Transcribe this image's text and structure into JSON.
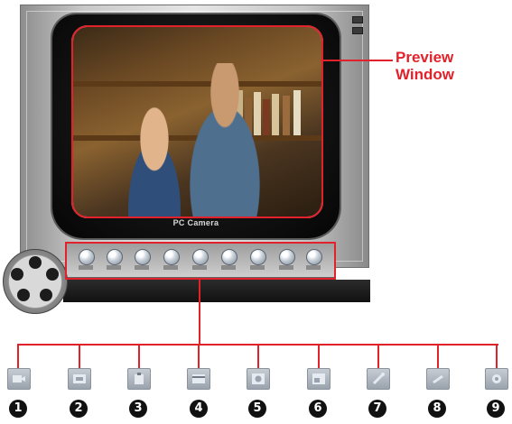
{
  "preview_label": {
    "line1": "Preview",
    "line2": "Window"
  },
  "brand_label": "PC Camera",
  "accent_color": "#e2222a",
  "toolbar": {
    "buttons": [
      {
        "icon": "camera-icon"
      },
      {
        "icon": "capture-icon"
      },
      {
        "icon": "clipboard-icon"
      },
      {
        "icon": "film-icon"
      },
      {
        "icon": "record-icon"
      },
      {
        "icon": "window-icon"
      },
      {
        "icon": "wrench-icon"
      },
      {
        "icon": "pen-icon"
      },
      {
        "icon": "gear-icon"
      }
    ]
  },
  "function_icons": [
    {
      "icon": "camera-icon",
      "number": "1"
    },
    {
      "icon": "capture-icon",
      "number": "2"
    },
    {
      "icon": "clipboard-icon",
      "number": "3"
    },
    {
      "icon": "film-icon",
      "number": "4"
    },
    {
      "icon": "record-icon",
      "number": "5"
    },
    {
      "icon": "window-icon",
      "number": "6"
    },
    {
      "icon": "wrench-icon",
      "number": "7"
    },
    {
      "icon": "pen-icon",
      "number": "8"
    },
    {
      "icon": "gear-icon",
      "number": "9"
    }
  ]
}
